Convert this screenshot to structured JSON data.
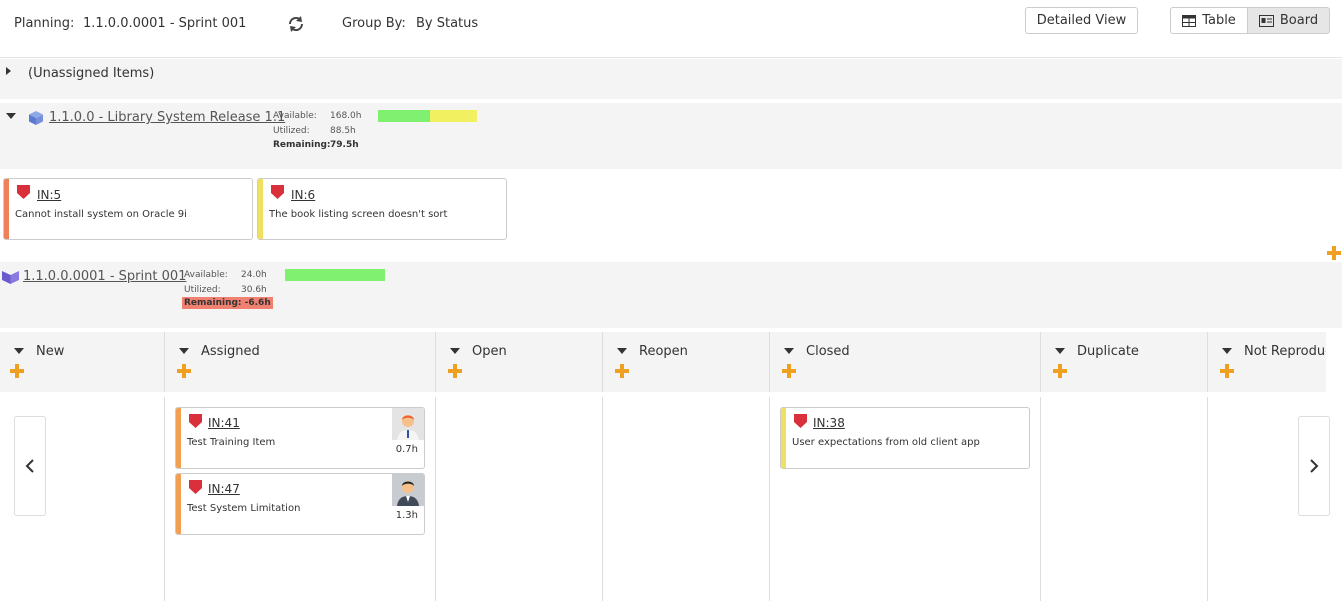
{
  "toolbar": {
    "planning_label": "Planning:",
    "planning_value": "1.1.0.0.0001 - Sprint 001",
    "refresh_icon": "refresh-icon",
    "groupby_label": "Group By:",
    "groupby_value": "By Status",
    "detailed_view": "Detailed View",
    "table_label": "Table",
    "board_label": "Board",
    "active_view": "Board"
  },
  "unassigned": {
    "label": "(Unassigned Items)"
  },
  "release": {
    "title": "1.1.0.0 - Library System Release 1.1",
    "available_label": "Available:",
    "available": "168.0h",
    "utilized_label": "Utilized:",
    "utilized": "88.5h",
    "remaining_label": "Remaining:",
    "remaining": "79.5h",
    "progress_fraction": 0.53,
    "cards": [
      {
        "id": "IN:5",
        "desc": "Cannot install system on Oracle 9i",
        "accent": "#f0805a"
      },
      {
        "id": "IN:6",
        "desc": "The book listing screen doesn't sort",
        "accent": "#f0e060"
      }
    ]
  },
  "sprint": {
    "title": "1.1.0.0.0001 - Sprint 001",
    "available_label": "Available:",
    "available": "24.0h",
    "utilized_label": "Utilized:",
    "utilized": "30.6h",
    "remaining_text": "Remaining: -6.6h",
    "progress_fraction": 1.0
  },
  "columns": [
    {
      "name": "New"
    },
    {
      "name": "Assigned"
    },
    {
      "name": "Open"
    },
    {
      "name": "Reopen"
    },
    {
      "name": "Closed"
    },
    {
      "name": "Duplicate"
    },
    {
      "name": "Not Reproducible"
    }
  ],
  "board_cards": {
    "assigned": [
      {
        "id": "IN:41",
        "desc": "Test Training Item",
        "hours": "0.7h",
        "accent": "#f0a050"
      },
      {
        "id": "IN:47",
        "desc": "Test System Limitation",
        "hours": "1.3h",
        "accent": "#f0a050"
      }
    ],
    "closed": [
      {
        "id": "IN:38",
        "desc": "User expectations from old client app",
        "accent": "#f0e060"
      }
    ]
  },
  "colors": {
    "accent_orange": "#f0a020",
    "shield_red": "#d9303c",
    "progress_green": "#80f070",
    "progress_yellow": "#f0f060",
    "remaining_negative": "#f08070"
  }
}
